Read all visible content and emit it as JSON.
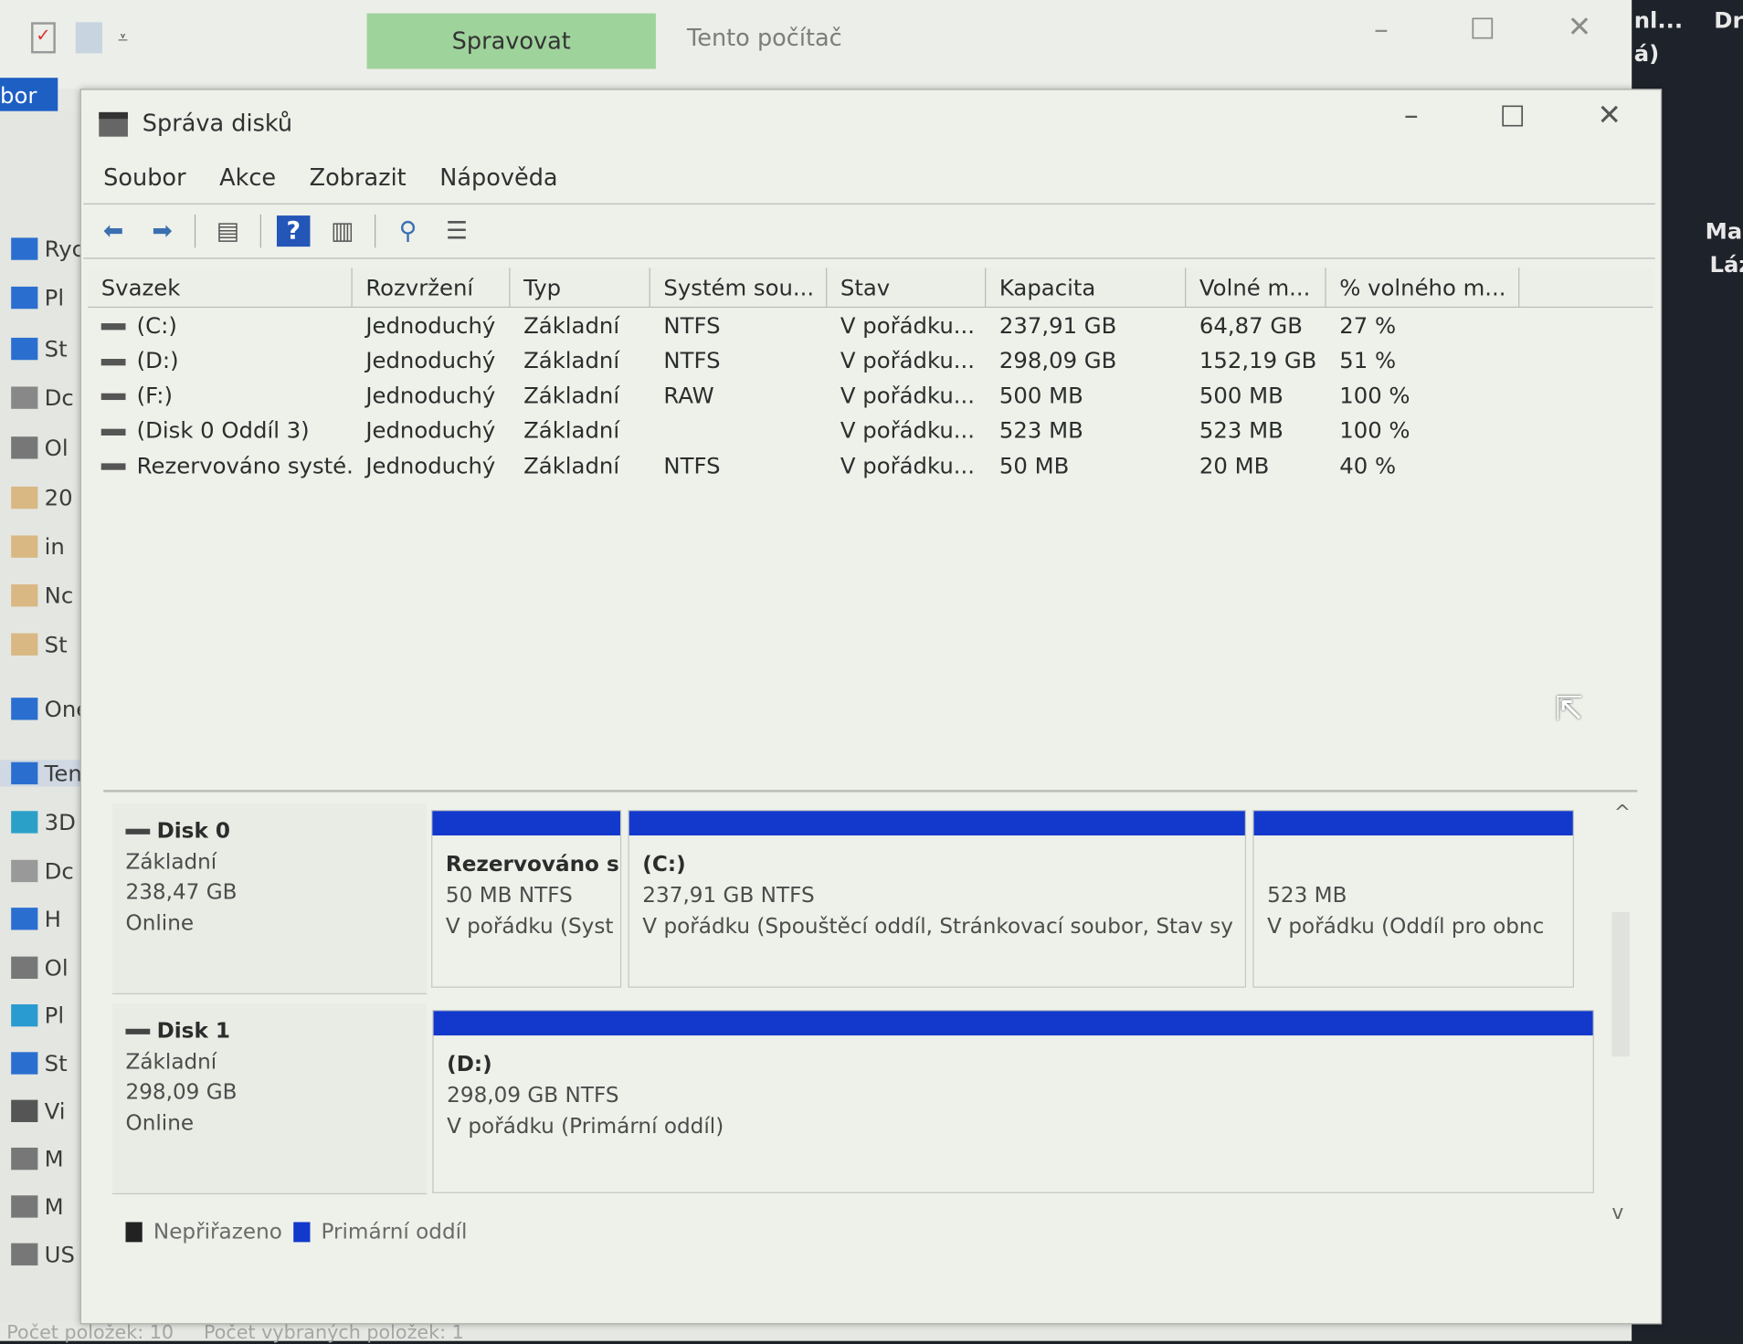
{
  "explorer": {
    "tab_manage": "Spravovat",
    "title": "Tento počítač",
    "ribbon_tab": "bor",
    "status_count": "Počet položek: 10",
    "status_selected": "Počet vybraných položek: 1",
    "nav": [
      "Ryc",
      "Pl",
      "St",
      "Dc",
      "Ol",
      "20",
      "in",
      "Nc",
      "St",
      "One",
      "Tent",
      "3D",
      "Dc",
      "H",
      "Ol",
      "Pl",
      "St",
      "Vi",
      "M",
      "M",
      "US"
    ]
  },
  "right_strip": {
    "texts": [
      "nl...",
      "á)",
      "Dr",
      "Ma",
      "Láz"
    ]
  },
  "dialog": {
    "title": "Správa disků",
    "menu": [
      "Soubor",
      "Akce",
      "Zobrazit",
      "Nápověda"
    ],
    "toolbar": [
      "back-arrow-icon",
      "forward-arrow-icon",
      "console-tree-icon",
      "help-icon",
      "action-pane-icon",
      "connect-icon",
      "properties-icon"
    ],
    "columns": [
      "Svazek",
      "Rozvržení",
      "Typ",
      "Systém sou...",
      "Stav",
      "Kapacita",
      "Volné m...",
      "% volného m..."
    ],
    "rows": [
      [
        "(C:)",
        "Jednoduchý",
        "Základní",
        "NTFS",
        "V pořádku...",
        "237,91 GB",
        "64,87 GB",
        "27 %"
      ],
      [
        "(D:)",
        "Jednoduchý",
        "Základní",
        "NTFS",
        "V pořádku...",
        "298,09 GB",
        "152,19 GB",
        "51 %"
      ],
      [
        "(F:)",
        "Jednoduchý",
        "Základní",
        "RAW",
        "V pořádku...",
        "500 MB",
        "500 MB",
        "100 %"
      ],
      [
        "(Disk 0 Oddíl 3)",
        "Jednoduchý",
        "Základní",
        "",
        "V pořádku...",
        "523 MB",
        "523 MB",
        "100 %"
      ],
      [
        "Rezervováno systé...",
        "Jednoduchý",
        "Základní",
        "NTFS",
        "V pořádku...",
        "50 MB",
        "20 MB",
        "40 %"
      ]
    ],
    "disks": [
      {
        "name": "Disk 0",
        "type": "Základní",
        "size": "238,47 GB",
        "state": "Online",
        "parts": [
          {
            "name": "Rezervováno s",
            "size": "50 MB NTFS",
            "status": "V pořádku (Syst"
          },
          {
            "name": "(C:)",
            "size": "237,91 GB NTFS",
            "status": "V pořádku (Spouštěcí oddíl, Stránkovací soubor, Stav sy"
          },
          {
            "name": "",
            "size": "523 MB",
            "status": "V pořádku (Oddíl pro obnc"
          }
        ]
      },
      {
        "name": "Disk 1",
        "type": "Základní",
        "size": "298,09 GB",
        "state": "Online",
        "parts": [
          {
            "name": "(D:)",
            "size": "298,09 GB NTFS",
            "status": "V pořádku (Primární oddíl)"
          }
        ]
      }
    ],
    "legend": [
      {
        "label": "Nepřiřazeno",
        "color": "#222222"
      },
      {
        "label": "Primární oddíl",
        "color": "#1239cc"
      }
    ]
  },
  "colors": {
    "partition_bar": "#1239cc",
    "manage_tab": "#9fd39c"
  }
}
